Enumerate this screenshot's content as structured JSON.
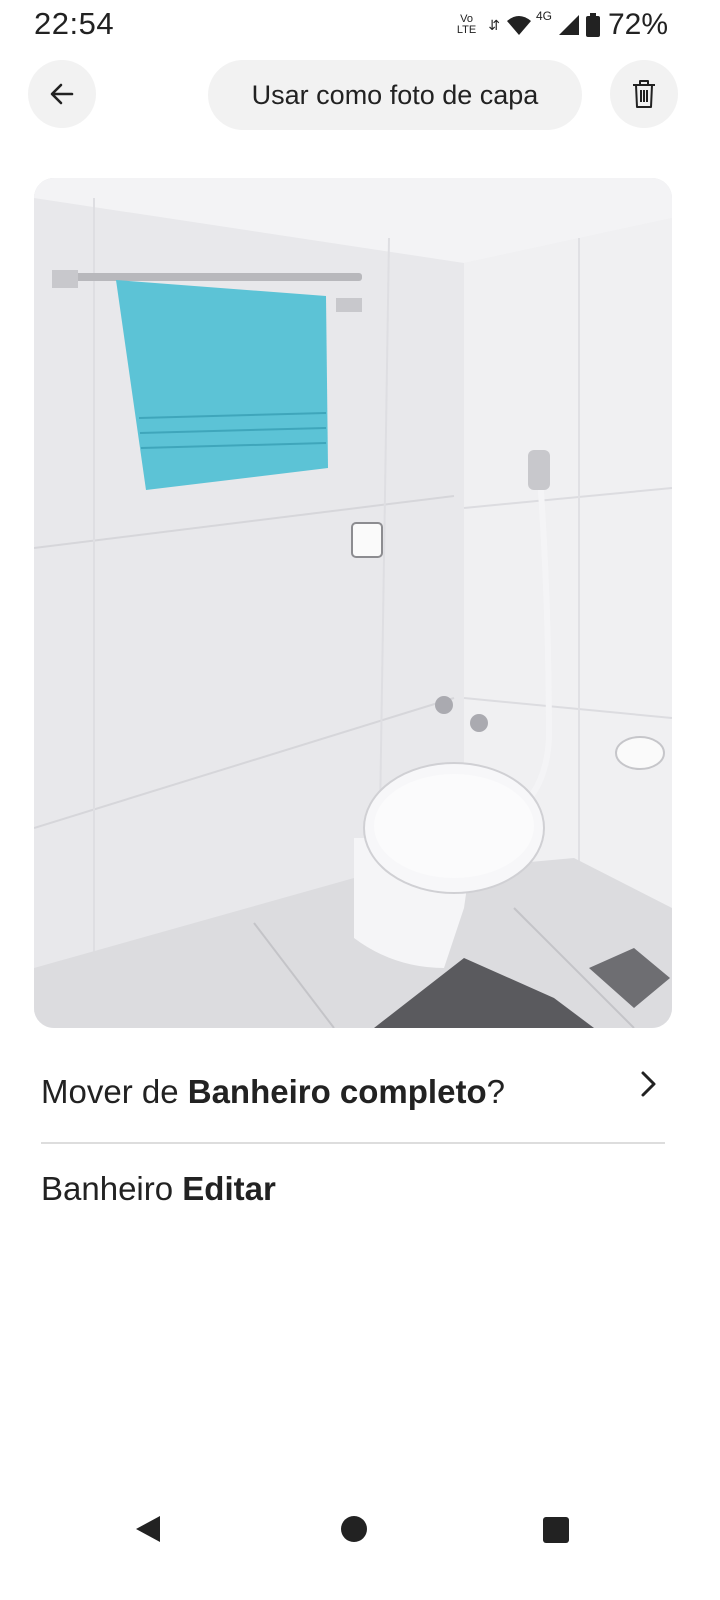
{
  "status_bar": {
    "time": "22:54",
    "volte_top": "Vo",
    "volte_bottom": "LTE",
    "network_type": "4G",
    "battery": "72%"
  },
  "top_bar": {
    "back_icon": "arrow-left-icon",
    "cover_button_label": "Usar como foto de capa",
    "delete_icon": "trash-icon"
  },
  "photo": {
    "subject": "bathroom-photo",
    "towel_color": "#5cc3d6"
  },
  "move": {
    "prefix": "Mover de ",
    "room": "Banheiro completo",
    "suffix": "?"
  },
  "room_row": {
    "room": "Banheiro",
    "action": "Editar"
  },
  "nav": {
    "back": "nav-back-icon",
    "home": "nav-home-icon",
    "recents": "nav-recents-icon"
  }
}
